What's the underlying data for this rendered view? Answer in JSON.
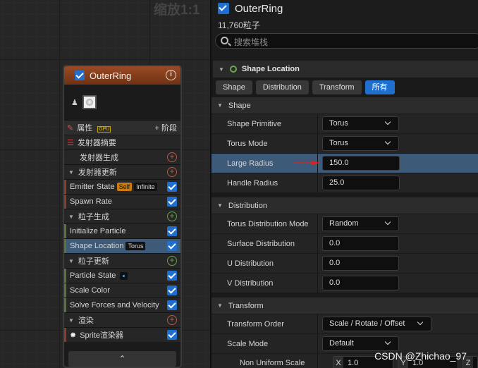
{
  "graph": {
    "zoom_label": "缩放1:1",
    "emitter": {
      "name": "OuterRing",
      "rows": {
        "properties": "属性",
        "gpu_badge": "GPU",
        "add_stage": "+ 阶段",
        "emitter_summary": "发射器摘要",
        "emitter_spawn": "发射器生成",
        "emitter_update": "发射器更新",
        "emitter_state": "Emitter State",
        "self_pill": "Self",
        "infinite_pill": "Infinite",
        "spawn_rate": "Spawn Rate",
        "particle_spawn": "粒子生成",
        "initialize_particle": "Initialize Particle",
        "shape_location": "Shape Location",
        "torus_pill": "Torus",
        "particle_update": "粒子更新",
        "particle_state": "Particle State",
        "scale_color": "Scale Color",
        "solve_forces": "Solve Forces and Velocity",
        "render": "渲染",
        "sprite_renderer": "Sprite渲染器"
      }
    }
  },
  "panel": {
    "title": "OuterRing",
    "particle_count": "11,760粒子",
    "search_placeholder": "搜索堆栈",
    "section_title": "Shape Location",
    "filter_tabs": [
      "Shape",
      "Distribution",
      "Transform",
      "所有"
    ],
    "active_tab": "所有",
    "groups": {
      "shape": "Shape",
      "distribution": "Distribution",
      "transform": "Transform"
    },
    "props": {
      "shape_primitive": {
        "label": "Shape Primitive",
        "value": "Torus"
      },
      "torus_mode": {
        "label": "Torus Mode",
        "value": "Torus"
      },
      "large_radius": {
        "label": "Large Radius",
        "value": "150.0"
      },
      "handle_radius": {
        "label": "Handle Radius",
        "value": "25.0"
      },
      "torus_distribution_mode": {
        "label": "Torus Distribution Mode",
        "value": "Random"
      },
      "surface_distribution": {
        "label": "Surface Distribution",
        "value": "0.0"
      },
      "u_distribution": {
        "label": "U Distribution",
        "value": "0.0"
      },
      "v_distribution": {
        "label": "V Distribution",
        "value": "0.0"
      },
      "transform_order": {
        "label": "Transform Order",
        "value": "Scale / Rotate / Offset"
      },
      "scale_mode": {
        "label": "Scale Mode",
        "value": "Default"
      },
      "non_uniform_scale": {
        "label": "Non Uniform Scale",
        "x_axis": "X",
        "x": "1.0",
        "y_axis": "Y",
        "y": "1.0",
        "z_axis": "Z"
      }
    }
  },
  "watermark": "CSDN @Zhichao_97",
  "colors": {
    "accent": "#1f6fd0",
    "selection": "#3d5a78",
    "emitter_header": "#8a4220",
    "arrow": "#e02020"
  }
}
